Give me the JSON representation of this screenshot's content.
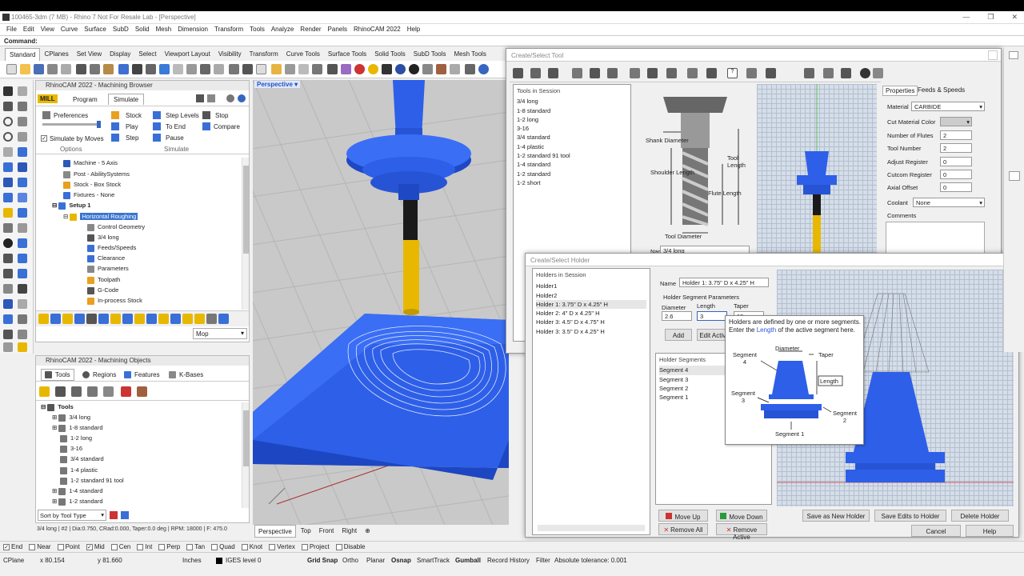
{
  "title_bar": {
    "text": "100465-3dm (7 MB) - Rhino 7 Not For Resale Lab - [Perspective]"
  },
  "menu": [
    "File",
    "Edit",
    "View",
    "Curve",
    "Surface",
    "SubD",
    "Solid",
    "Mesh",
    "Dimension",
    "Transform",
    "Tools",
    "Analyze",
    "Render",
    "Panels",
    "RhinoCAM 2022",
    "Help"
  ],
  "command": {
    "label": "Command:"
  },
  "toolbar_tabs": [
    "Standard",
    "CPlanes",
    "Set View",
    "Display",
    "Select",
    "Viewport Layout",
    "Visibility",
    "Transform",
    "Curve Tools",
    "Surface Tools",
    "Solid Tools",
    "SubD Tools",
    "Mesh Tools"
  ],
  "browser": {
    "title": "RhinoCAM 2022 - Machining Browser",
    "tabs": [
      "MILL",
      "Program",
      "Simulate"
    ],
    "col1": [
      "Preferences",
      "Simulate by Moves"
    ],
    "stock": [
      "Stock",
      "Play",
      "Step"
    ],
    "levels": [
      "Step Levels",
      "To End",
      "Pause"
    ],
    "stop": [
      "Stop",
      "Compare"
    ],
    "group_labels": [
      "Options",
      "Simulate"
    ],
    "tree": [
      "Machine - 5 Axis",
      "Post - AbilitySystems",
      "Stock - Box Stock",
      "Fixtures - None",
      "Setup 1",
      "Horizontal Roughing",
      "Control Geometry",
      "3/4 long",
      "Feeds/Speeds",
      "Clearance",
      "Parameters",
      "Toolpath",
      "G-Code",
      "In-process Stock"
    ],
    "dropdown": "Mop"
  },
  "objects": {
    "title": "RhinoCAM 2022 - Machining Objects",
    "tabs": [
      "Tools",
      "Regions",
      "Features",
      "K-Bases"
    ],
    "root": "Tools",
    "tools": [
      "3/4 long",
      "1-8 standard",
      "1-2 long",
      "3-16",
      "3/4 standard",
      "1-4 plastic",
      "1-2 standard 91 tool",
      "1-4 standard",
      "1-2 standard"
    ],
    "sort": "Sort by Tool Type",
    "status": "3/4 long | #2 | Dia:0.750, CRad:0.000, Taper:0.0 deg | RPM: 18000 | F: 475.0"
  },
  "viewport": {
    "name": "Perspective",
    "tabs": [
      "Perspective",
      "Top",
      "Front",
      "Right"
    ]
  },
  "tool_dialog": {
    "title": "Create/Select Tool",
    "list_header": "Tools in Session",
    "tools": [
      "3/4 long",
      "1-8 standard",
      "1-2 long",
      "3-16",
      "3/4 standard",
      "1-4 plastic",
      "1-2 standard 91 tool",
      "1-4 standard",
      "1-2 standard",
      "1-2 short"
    ],
    "diagram_labels": [
      "Shank Diameter",
      "Shoulder Length",
      "Tool Length",
      "Flute Length",
      "Tool Diameter"
    ],
    "name_label": "Name",
    "name_value": "3/4 long",
    "tabs": [
      "Properties",
      "Feeds & Speeds"
    ],
    "props": [
      {
        "label": "Material",
        "value": "CARBIDE"
      },
      {
        "label": "Cut Material Color",
        "value": ""
      },
      {
        "label": "Number of Flutes",
        "value": "2"
      },
      {
        "label": "Tool Number",
        "value": "2"
      },
      {
        "label": "Adjust Register",
        "value": "0"
      },
      {
        "label": "Cutcom Register",
        "value": "0"
      },
      {
        "label": "Axial Offset",
        "value": "0"
      },
      {
        "label": "Coolant",
        "value": "None"
      }
    ],
    "comments": "Comments"
  },
  "holder_dialog": {
    "title": "Create/Select Holder",
    "list_header": "Holders in Session",
    "holders": [
      "Holder1",
      "Holder2",
      "Holder 1: 3.75\" D x 4.25\" H",
      "Holder 2: 4\" D x 4.25\" H",
      "Holder 3: 4.5\" D x 4.75\" H",
      "Holder 3: 3.5\" D x 4.25\" H"
    ],
    "name_label": "Name",
    "name_value": "Holder 1: 3.75\" D x 4.25\" H",
    "params_label": "Holder Segment Parameters",
    "param_labels": [
      "Diameter",
      "Length",
      "Taper"
    ],
    "param_values": [
      "2.6",
      "3",
      "10"
    ],
    "add": "Add",
    "edit_active": "Edit Active",
    "segments_header": "Holder Segments",
    "segments": [
      "Segment 4",
      "Segment 3",
      "Segment 2",
      "Segment 1"
    ],
    "move_up": "Move Up",
    "move_down": "Move Down",
    "remove_all": "Remove All",
    "remove_active": "Remove Active",
    "save_new": "Save as New Holder",
    "save_edits": "Save Edits to Holder",
    "delete": "Delete Holder",
    "cancel": "Cancel",
    "help": "Help"
  },
  "tooltip": {
    "text1": "Holders are defined by one or more segments.  Enter the ",
    "text_link": "Length",
    "text2": " of the active segment here.",
    "labels": [
      "Diameter",
      "Taper",
      "Segment 4",
      "Length",
      "Segment 3",
      "Segment 2",
      "Segment 1"
    ]
  },
  "osnaps": [
    {
      "label": "End",
      "on": true
    },
    {
      "label": "Near",
      "on": false
    },
    {
      "label": "Point",
      "on": false
    },
    {
      "label": "Mid",
      "on": true
    },
    {
      "label": "Cen",
      "on": false
    },
    {
      "label": "Int",
      "on": false
    },
    {
      "label": "Perp",
      "on": false
    },
    {
      "label": "Tan",
      "on": false
    },
    {
      "label": "Quad",
      "on": false
    },
    {
      "label": "Knot",
      "on": false
    },
    {
      "label": "Vertex",
      "on": false
    },
    {
      "label": "Project",
      "on": false
    },
    {
      "label": "Disable",
      "on": false
    }
  ],
  "status": {
    "cplane": "CPlane",
    "x": "x 80.154",
    "y": "y 81.660",
    "units": "Inches",
    "layer": "IGES level 0",
    "buttons": [
      "Grid Snap",
      "Ortho",
      "Planar",
      "Osnap",
      "SmartTrack",
      "Gumball",
      "Record History",
      "Filter"
    ],
    "tolerance": "Absolute tolerance: 0.001"
  },
  "colors": {
    "accent_blue": "#2a56e0",
    "tool_yellow": "#e8b800",
    "selection": "#3a74d0"
  }
}
